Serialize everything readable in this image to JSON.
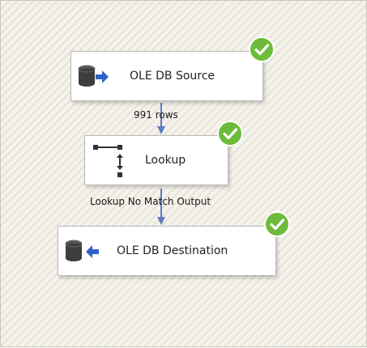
{
  "tasks": [
    {
      "id": "source",
      "label": "OLE DB Source",
      "icon": "database-source-icon",
      "status": "success-check-icon"
    },
    {
      "id": "lookup",
      "label": "Lookup",
      "icon": "lookup-icon",
      "status": "success-check-icon"
    },
    {
      "id": "destination",
      "label": "OLE DB Destination",
      "icon": "database-destination-icon",
      "status": "success-check-icon"
    }
  ],
  "paths": [
    {
      "label": "991 rows"
    },
    {
      "label": "Lookup No Match Output"
    }
  ],
  "colors": {
    "success": "#6dbb3a",
    "arrow": "#4a6fb5",
    "db_dark": "#3d3d3d"
  }
}
